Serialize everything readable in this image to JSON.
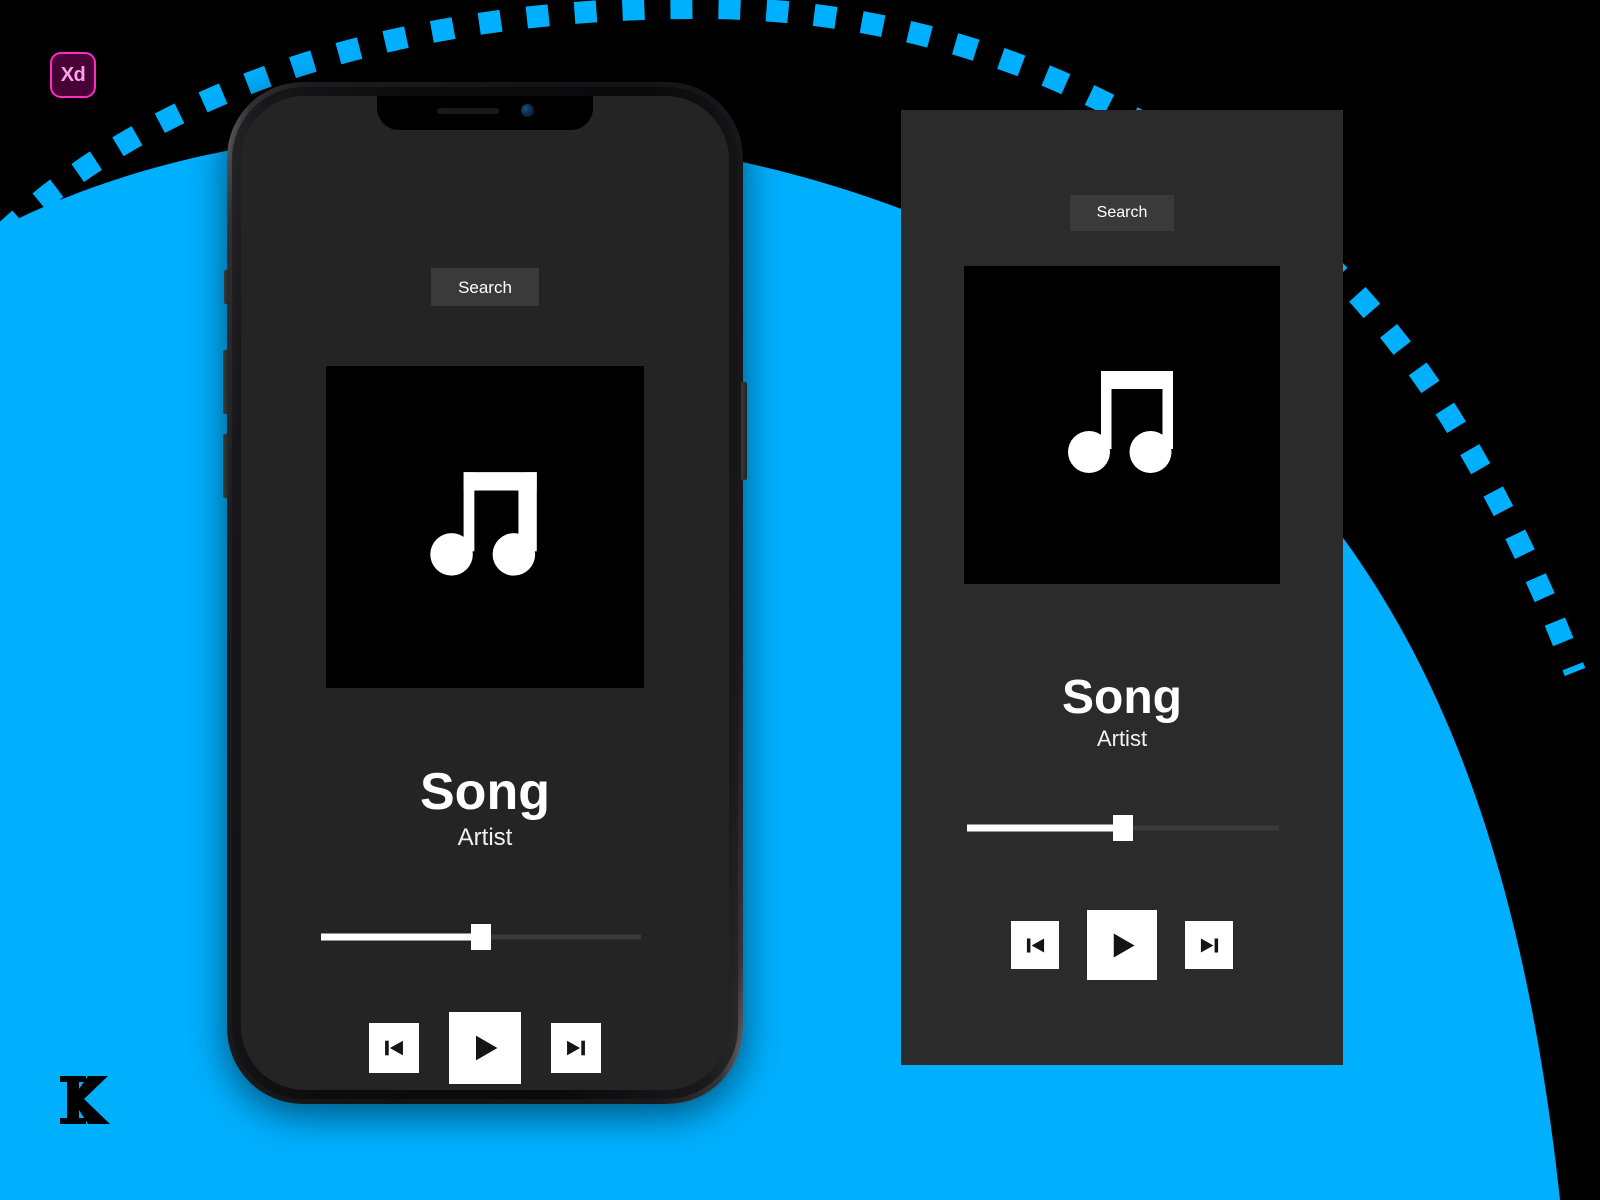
{
  "background": {
    "page_bg": "#000000",
    "accent_cyan": "#00B0FF",
    "dashed_arc_color": "#00B0FF"
  },
  "branding": {
    "xd_badge": {
      "label": "Xd",
      "bg": "#470137",
      "border": "#FF2BC2",
      "text_color": "#FFA0E8"
    },
    "k_logo_name": "k-logo",
    "k_logo_color": "#000000"
  },
  "phone_mockup": {
    "device": "iphone-x",
    "notch": {
      "speaker": "earpiece-speaker",
      "camera": "front-camera"
    },
    "side_buttons": [
      "mute-switch",
      "volume-up",
      "volume-down",
      "power"
    ]
  },
  "screens": [
    {
      "id": "phone-screen",
      "background": "#242424",
      "search": {
        "label": "Search",
        "bg": "#3A3A3A",
        "text_color": "#FFFFFF"
      },
      "album_art": {
        "icon": "music-note-icon",
        "bg": "#000000",
        "icon_color": "#FFFFFF"
      },
      "song_title": "Song",
      "artist": "Artist",
      "progress": {
        "value_percent": 50,
        "fill_color": "#FFFFFF",
        "track_color": "#3A3A3A",
        "thumb": "square-thumb"
      },
      "controls": [
        {
          "name": "previous-button",
          "icon": "skip-back-icon"
        },
        {
          "name": "play-button",
          "icon": "play-icon"
        },
        {
          "name": "next-button",
          "icon": "skip-forward-icon"
        }
      ]
    },
    {
      "id": "flat-panel-screen",
      "background": "#2B2B2B",
      "search": {
        "label": "Search",
        "bg": "#3A3A3A",
        "text_color": "#FFFFFF"
      },
      "album_art": {
        "icon": "music-note-icon",
        "bg": "#000000",
        "icon_color": "#FFFFFF"
      },
      "song_title": "Song",
      "artist": "Artist",
      "progress": {
        "value_percent": 50,
        "fill_color": "#FFFFFF",
        "track_color": "#3A3A3A",
        "thumb": "square-thumb"
      },
      "controls": [
        {
          "name": "previous-button",
          "icon": "skip-back-icon"
        },
        {
          "name": "play-button",
          "icon": "play-icon"
        },
        {
          "name": "next-button",
          "icon": "skip-forward-icon"
        }
      ]
    }
  ]
}
